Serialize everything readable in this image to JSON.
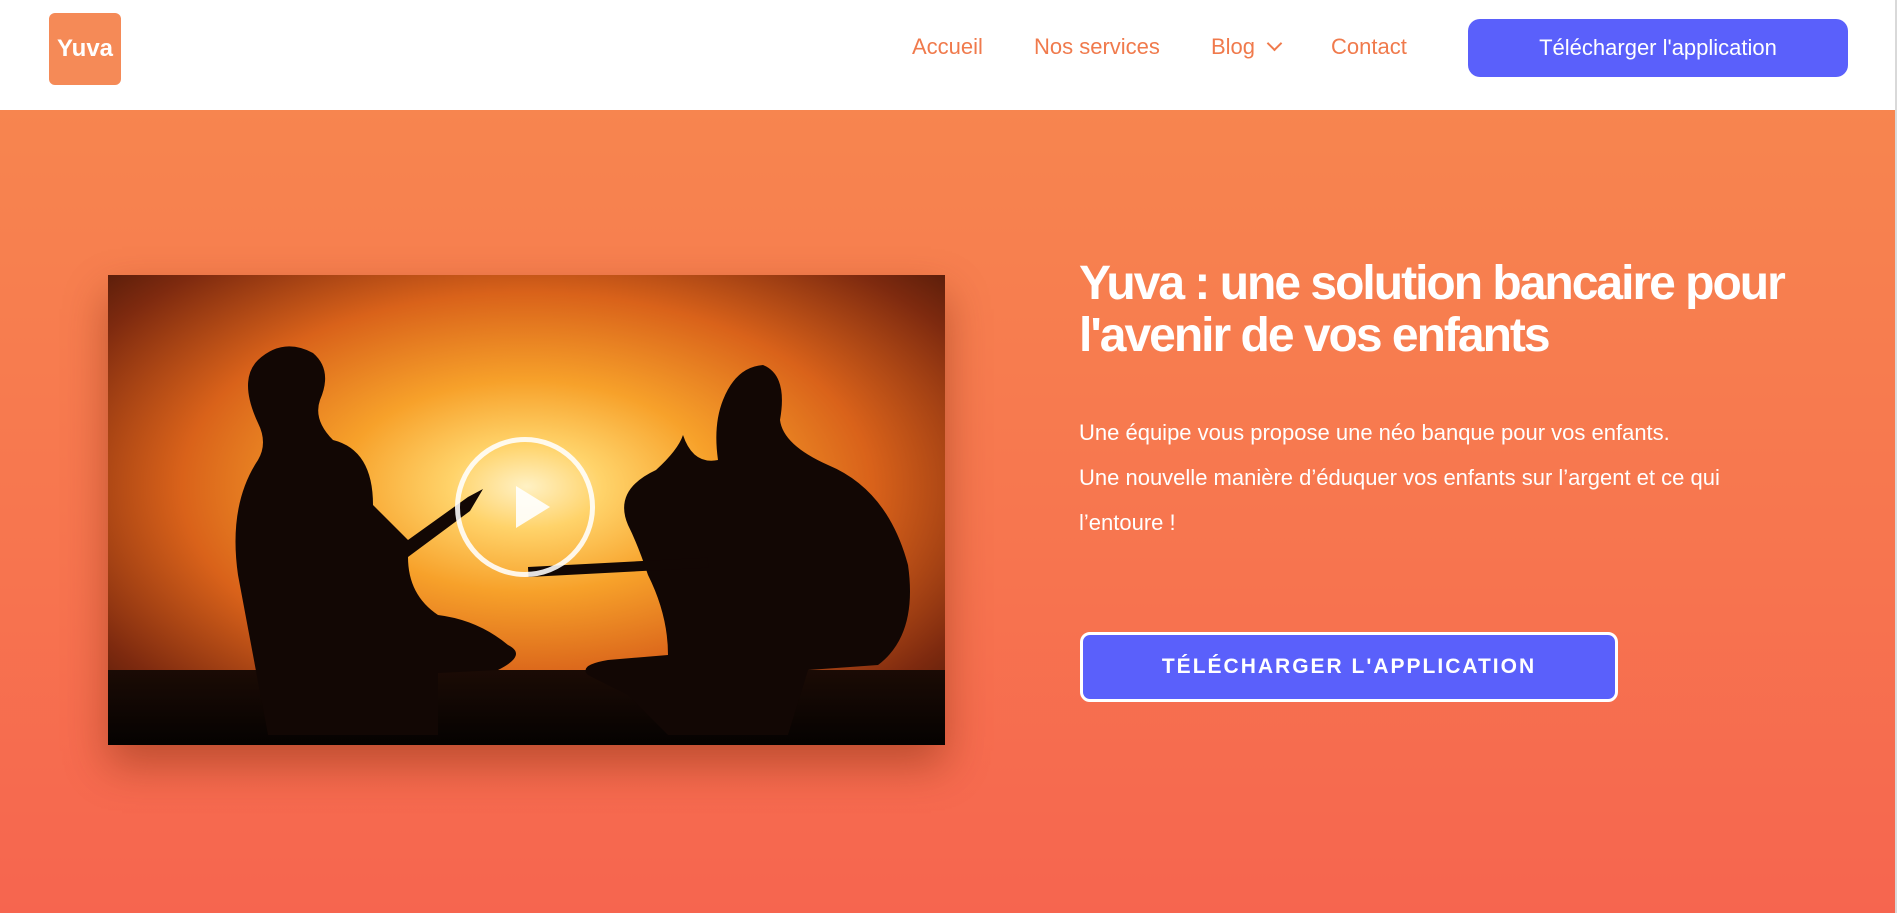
{
  "brand": {
    "logo_text": "Yuva",
    "accent": "#f58a57"
  },
  "nav": {
    "items": [
      {
        "label": "Accueil"
      },
      {
        "label": "Nos services"
      },
      {
        "label": "Blog",
        "has_dropdown": true
      },
      {
        "label": "Contact"
      }
    ],
    "cta_label": "Télécharger l'application"
  },
  "hero": {
    "title": "Yuva : une solution bancaire pour l'avenir de vos enfants",
    "description_lines": [
      "Une équipe vous propose une néo banque pour vos enfants.",
      "Une nouvelle manière d’éduquer vos enfants sur l’argent et ce qui l’entoure !"
    ],
    "cta_label": "TÉLÉCHARGER L'APPLICATION",
    "video": {
      "icon": "play-icon",
      "thumbnail": "two guitarists silhouetted at sunset"
    }
  },
  "colors": {
    "primary_button": "#5a60fb",
    "nav_text": "#f07a4c",
    "hero_gradient_top": "#f7854f",
    "hero_gradient_bottom": "#f6654f"
  }
}
